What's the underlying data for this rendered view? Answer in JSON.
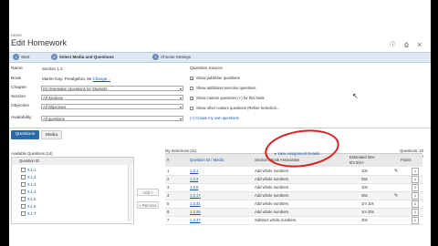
{
  "header": {
    "course": "DEMO",
    "title": "Edit Homework",
    "icons": [
      "ⓘ",
      "⎙",
      "✕"
    ]
  },
  "tabs": [
    {
      "label": "Start"
    },
    {
      "label": "Select Media and Questions"
    },
    {
      "label": "Choose Settings"
    }
  ],
  "form": {
    "name": {
      "label": "Name",
      "value": "Section 1.3"
    },
    "book": {
      "label": "Book",
      "value": "Martin-Gay: Prealgebra, 8e",
      "change": "Change..."
    },
    "chapter": {
      "label": "Chapter",
      "value": "(0) Orientation Questions for Students"
    },
    "section": {
      "label": "Section",
      "value": "All Sections"
    },
    "objective": {
      "label": "Objective",
      "value": "All Objectives"
    },
    "availability": {
      "label": "Availability",
      "value": "All questions"
    }
  },
  "question_source": {
    "title": "Question Source",
    "options": [
      "Show publisher questions",
      "Show additional exercise questions",
      "Show custom questions (+) for this book",
      "Show other custom questions (Refine Selection..."
    ],
    "create_link": "(+) Create my own questions"
  },
  "buttons": {
    "questions": "Questions",
    "media": "Media",
    "add": "Add »",
    "remove": "« Remove"
  },
  "available": {
    "title": "Available Questions (14)",
    "header": "Question ID",
    "items": [
      "0.1.1",
      "0.1.2",
      "0.1.3",
      "0.1.4",
      "0.1.5",
      "0.1.6",
      "0.1.7"
    ]
  },
  "selection": {
    "title": "My Selections (11)",
    "questions_count": "Questions: 10",
    "points_count": "Points: 10",
    "view_details": "▸ View Assignment Details",
    "columns": [
      "#",
      "Question ID / Media",
      "Section / Book Association",
      "Estimated time",
      "5m 51s+",
      "Points"
    ],
    "rows": [
      {
        "num": "1",
        "id": "1.3.1",
        "section": "Add whole numbers.",
        "time": "10s",
        "points": "1"
      },
      {
        "num": "2",
        "id": "1.3.3",
        "section": "Add whole numbers.",
        "time": "25s",
        "points": "1"
      },
      {
        "num": "3",
        "id": "1.3.5",
        "section": "Add whole numbers.",
        "time": "10s",
        "points": "1"
      },
      {
        "num": "4",
        "id": "1.3.17",
        "section": "Add whole numbers.",
        "time": "45s",
        "points": "1"
      },
      {
        "num": "5",
        "id": "1.3.31",
        "section": "Add whole numbers.",
        "time": "1m 10s",
        "points": "1"
      },
      {
        "num": "6",
        "id": "1.3.25",
        "section": "Add whole numbers.",
        "time": "1m 20s",
        "points": "1"
      },
      {
        "num": "7",
        "id": "1.3.47",
        "section": "Subtract whole numbers.",
        "time": "30s",
        "points": "1"
      }
    ]
  }
}
